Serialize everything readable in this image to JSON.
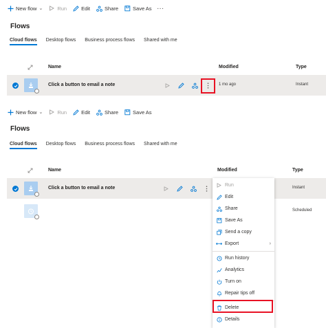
{
  "toolbar": {
    "new_flow": "New flow",
    "run": "Run",
    "edit": "Edit",
    "share": "Share",
    "save_as": "Save As",
    "more": "···"
  },
  "page": {
    "title": "Flows",
    "tabs": [
      "Cloud flows",
      "Desktop flows",
      "Business process flows",
      "Shared with me"
    ]
  },
  "table": {
    "col_name": "Name",
    "col_modified": "Modified",
    "col_type": "Type",
    "rows": [
      {
        "name": "Click a button to email a note",
        "modified": "1 mo ago",
        "type": "Instant"
      },
      {
        "name": "",
        "modified": "",
        "type": "Scheduled"
      }
    ]
  },
  "context_menu": {
    "items": [
      "Run",
      "Edit",
      "Share",
      "Save As",
      "Send a copy",
      "Export",
      "Run history",
      "Analytics",
      "Turn on",
      "Repair tips off",
      "Delete",
      "Details"
    ]
  },
  "colors": {
    "accent": "#0078d4",
    "highlight": "#e81123",
    "selected_row": "#edebe9"
  }
}
